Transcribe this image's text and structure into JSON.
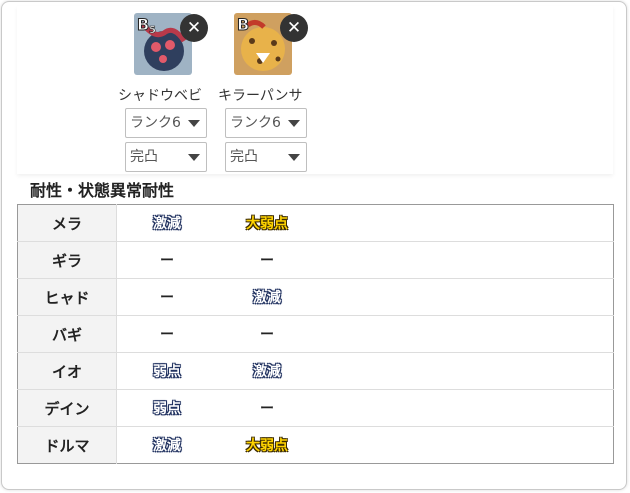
{
  "monsters": [
    {
      "name": "シャドウベビ",
      "close_icon": "✕",
      "rank_label": "B",
      "rank_num": "5",
      "rank_select": "ランク6",
      "limit_select": "完凸"
    },
    {
      "name": "キラーパンサ",
      "close_icon": "✕",
      "rank_label": "B",
      "rank_num": "",
      "rank_select": "ランク6",
      "limit_select": "完凸"
    }
  ],
  "section_title": "耐性・状態異常耐性",
  "resist_rows": [
    {
      "label": "メラ",
      "v1": "激減",
      "v2": "大弱点"
    },
    {
      "label": "ギラ",
      "v1": "ー",
      "v2": "ー"
    },
    {
      "label": "ヒャド",
      "v1": "ー",
      "v2": "激減"
    },
    {
      "label": "バギ",
      "v1": "ー",
      "v2": "ー"
    },
    {
      "label": "イオ",
      "v1": "弱点",
      "v2": "激減"
    },
    {
      "label": "デイン",
      "v1": "弱点",
      "v2": "ー"
    },
    {
      "label": "ドルマ",
      "v1": "激減",
      "v2": "大弱点"
    }
  ],
  "colors": {
    "weak_big": "#ffd400",
    "badge": "#ffffff",
    "badge_outline": "#1e2f5e"
  }
}
